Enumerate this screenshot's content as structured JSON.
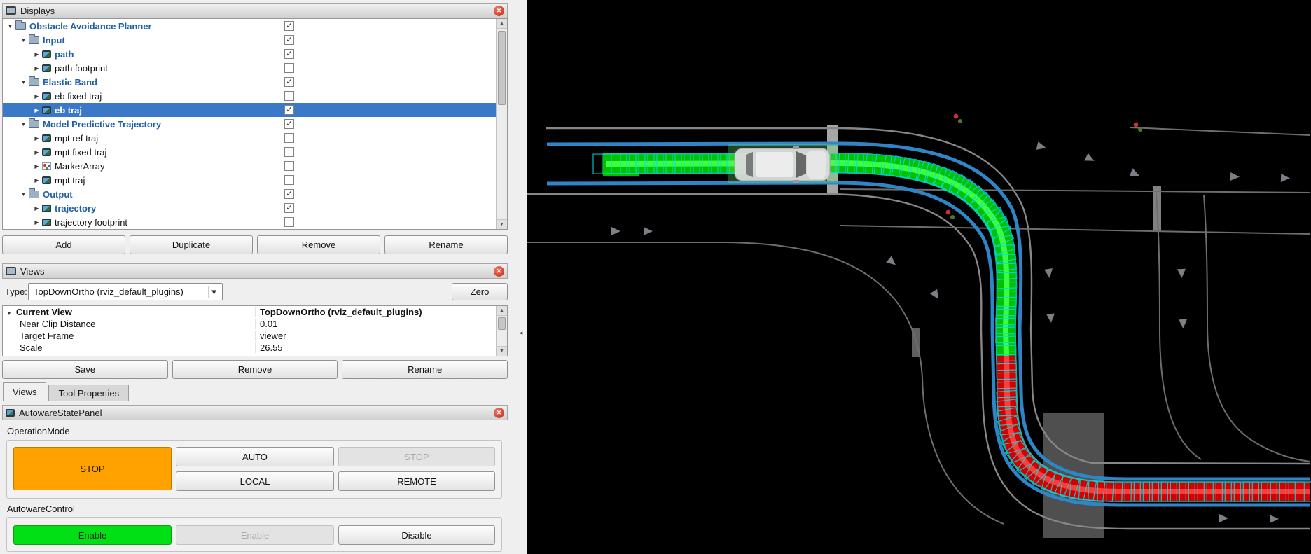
{
  "displays_panel": {
    "title": "Displays",
    "tree": [
      {
        "label": "Obstacle Avoidance Planner",
        "level": 0,
        "icon": "folder",
        "expanded": true,
        "checked": true,
        "blue": true,
        "bold": true
      },
      {
        "label": "Input",
        "level": 1,
        "icon": "folder",
        "expanded": true,
        "checked": true,
        "blue": true,
        "bold": true
      },
      {
        "label": "path",
        "level": 2,
        "icon": "display",
        "expanded": false,
        "checked": true,
        "blue": true,
        "bold": true
      },
      {
        "label": "path footprint",
        "level": 2,
        "icon": "display",
        "expanded": false,
        "checked": false
      },
      {
        "label": "Elastic Band",
        "level": 1,
        "icon": "folder",
        "expanded": true,
        "checked": true,
        "blue": true,
        "bold": true
      },
      {
        "label": "eb fixed traj",
        "level": 2,
        "icon": "display",
        "expanded": false,
        "checked": false
      },
      {
        "label": "eb traj",
        "level": 2,
        "icon": "display",
        "expanded": false,
        "checked": true,
        "selected": true,
        "bold": true
      },
      {
        "label": "Model Predictive Trajectory",
        "level": 1,
        "icon": "folder",
        "expanded": true,
        "checked": true,
        "blue": true,
        "bold": true
      },
      {
        "label": "mpt ref traj",
        "level": 2,
        "icon": "display",
        "expanded": false,
        "checked": false
      },
      {
        "label": "mpt fixed traj",
        "level": 2,
        "icon": "display",
        "expanded": false,
        "checked": false
      },
      {
        "label": "MarkerArray",
        "level": 2,
        "icon": "marker",
        "expanded": false,
        "checked": false
      },
      {
        "label": "mpt traj",
        "level": 2,
        "icon": "display",
        "expanded": false,
        "checked": false
      },
      {
        "label": "Output",
        "level": 1,
        "icon": "folder",
        "expanded": true,
        "checked": true,
        "blue": true,
        "bold": true
      },
      {
        "label": "trajectory",
        "level": 2,
        "icon": "display",
        "expanded": false,
        "checked": true,
        "blue": true,
        "bold": true
      },
      {
        "label": "trajectory footprint",
        "level": 2,
        "icon": "display",
        "expanded": false,
        "checked": false
      }
    ],
    "buttons": [
      {
        "label": "Add"
      },
      {
        "label": "Duplicate"
      },
      {
        "label": "Remove"
      },
      {
        "label": "Rename"
      }
    ]
  },
  "views_panel": {
    "title": "Views",
    "type_label": "Type:",
    "type_value": "TopDownOrtho (rviz_default_plugins)",
    "zero_button": "Zero",
    "properties": [
      {
        "name": "Current View",
        "value": "TopDownOrtho (rviz_default_plugins)"
      },
      {
        "name": "Near Clip Distance",
        "value": "0.01"
      },
      {
        "name": "Target Frame",
        "value": "viewer"
      },
      {
        "name": "Scale",
        "value": "26.55"
      }
    ],
    "buttons": [
      {
        "label": "Save"
      },
      {
        "label": "Remove"
      },
      {
        "label": "Rename"
      }
    ]
  },
  "dock_tabs": {
    "tabs": [
      {
        "label": "Views",
        "active": true
      },
      {
        "label": "Tool Properties",
        "active": false
      }
    ]
  },
  "state_panel": {
    "title": "AutowareStatePanel",
    "operation_mode": {
      "label": "OperationMode",
      "stop_button": "STOP",
      "auto_button": "AUTO",
      "stop_secondary_button": "STOP",
      "local_button": "LOCAL",
      "remote_button": "REMOTE"
    },
    "autoware_control": {
      "label": "AutowareControl",
      "enable_button": "Enable",
      "enable_disabled_button": "Enable",
      "disable_button": "Disable"
    },
    "colors": {
      "stop_active": "#ffa200",
      "enable_active": "#00e014"
    }
  },
  "viewport": {
    "colors": {
      "background": "#000000",
      "reference_trajectory": "#00c000",
      "optimized_trajectory": "#d40000",
      "footprint": "#00e0e0",
      "lane_boundary": "#2e86c8",
      "road_line": "#878787"
    }
  }
}
